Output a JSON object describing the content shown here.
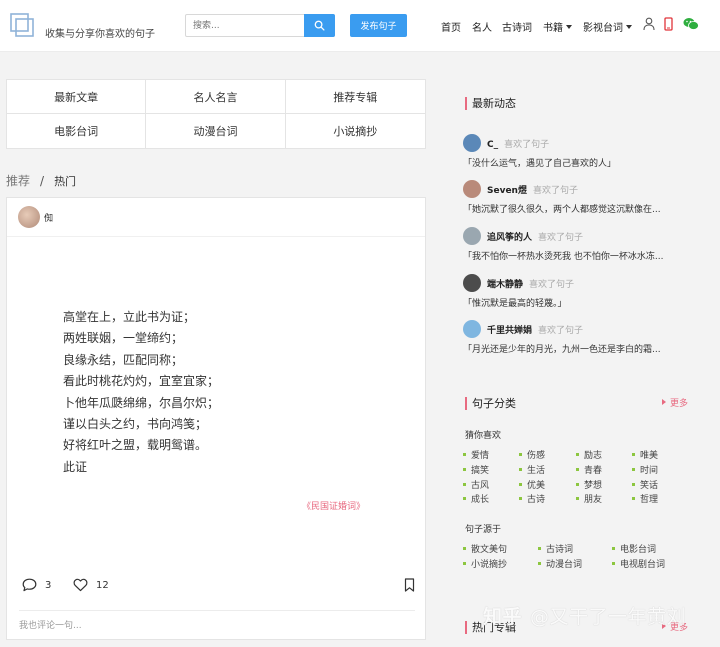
{
  "header": {
    "slogan": "收集与分享你喜欢的句子",
    "search_placeholder": "搜索...",
    "publish_label": "发布句子",
    "nav": [
      {
        "label": "首页",
        "dropdown": false
      },
      {
        "label": "名人",
        "dropdown": false
      },
      {
        "label": "古诗词",
        "dropdown": false
      },
      {
        "label": "书籍",
        "dropdown": true
      },
      {
        "label": "影视台词",
        "dropdown": true
      }
    ],
    "icons": [
      "user-icon",
      "phone-icon",
      "wechat-icon"
    ],
    "accent": "#3a9cf0"
  },
  "categories": [
    "最新文章",
    "名人名言",
    "推荐专辑",
    "电影台词",
    "动漫台词",
    "小说摘抄"
  ],
  "breadcrumb": {
    "root": "推荐",
    "sep": "/",
    "current": "热门"
  },
  "post": {
    "author": "倁",
    "lines": [
      "高堂在上，立此书为证；",
      "两姓联姻，一堂缔约；",
      "良缘永结，匹配同称；",
      "看此时桃花灼灼，宜室宜家；",
      "卜他年瓜瓞绵绵，尔昌尔炽；",
      "谨以白头之约，书向鸿笺；",
      "好将红叶之盟，载明鸳谱。",
      "此证"
    ],
    "source": "《民国证婚词》",
    "comment_count": "3",
    "like_count": "12",
    "comment_placeholder": "我也评论一句..."
  },
  "sidebar": {
    "activity_title": "最新动态",
    "activities": [
      {
        "user": "C_",
        "action": "喜欢了句子",
        "quote": "「没什么运气，遇见了自己喜欢的人」",
        "avatar_color": "#5b88b8"
      },
      {
        "user": "Seven煜",
        "action": "喜欢了句子",
        "quote": "「她沉默了很久很久，两个人都感觉这沉默像在...",
        "avatar_color": "#b98a7a"
      },
      {
        "user": "追风筝的人",
        "action": "喜欢了句子",
        "quote": "「我不怕你一杯热水烫死我 也不怕你一杯冰水冻...",
        "avatar_color": "#9aa7b0"
      },
      {
        "user": "端木静静",
        "action": "喜欢了句子",
        "quote": "「惟沉默是最高的轻蔑。」",
        "avatar_color": "#4c4c4c"
      },
      {
        "user": "千里共婵娟",
        "action": "喜欢了句子",
        "quote": "「月光还是少年的月光，九州一色还是李白的霜...",
        "avatar_color": "#7fb6e0"
      }
    ],
    "category_title": "句子分类",
    "more_label": "更多",
    "guess_title": "猜你喜欢",
    "guess_tags": [
      "爱情",
      "伤感",
      "励志",
      "唯美",
      "搞笑",
      "生活",
      "青春",
      "时间",
      "古风",
      "优美",
      "梦想",
      "笑话",
      "成长",
      "古诗",
      "朋友",
      "哲理"
    ],
    "source_title": "句子源于",
    "source_tags": [
      "散文美句",
      "古诗词",
      "电影台词",
      "小说摘抄",
      "动漫台词",
      "电视剧台词"
    ],
    "hot_title": "热门专辑",
    "hot_more_label": "更多"
  },
  "watermark": {
    "brand": "知乎",
    "text": "@又干了一年黄刘"
  }
}
